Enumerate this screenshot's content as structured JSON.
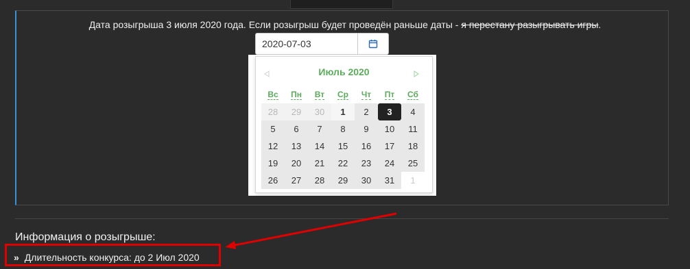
{
  "notice": {
    "text": "Дата розыгрыша 3 июля 2020 года. Если розыгрыш будет проведён раньше даты - ",
    "strike": "я перестану разыгрывать игры",
    "end": "."
  },
  "date_input": {
    "value": "2020-07-03"
  },
  "calendar": {
    "month_label": "Июль 2020",
    "weekdays": [
      "Вс",
      "Пн",
      "Вт",
      "Ср",
      "Чт",
      "Пт",
      "Сб"
    ],
    "weeks": [
      [
        "28",
        "29",
        "30",
        "1",
        "2",
        "3",
        "4"
      ],
      [
        "5",
        "6",
        "7",
        "8",
        "9",
        "10",
        "11"
      ],
      [
        "12",
        "13",
        "14",
        "15",
        "16",
        "17",
        "18"
      ],
      [
        "19",
        "20",
        "21",
        "22",
        "23",
        "24",
        "25"
      ],
      [
        "26",
        "27",
        "28",
        "29",
        "30",
        "31",
        "1"
      ]
    ],
    "selected_day": "3"
  },
  "info": {
    "title": "Информация о розыгрыше:",
    "duration": "Длительность конкурса: до 2 Июл 2020"
  },
  "colors": {
    "accent_green": "#5cab5c",
    "highlight_red": "#e00000",
    "panel_accent": "#3b8fd6"
  }
}
